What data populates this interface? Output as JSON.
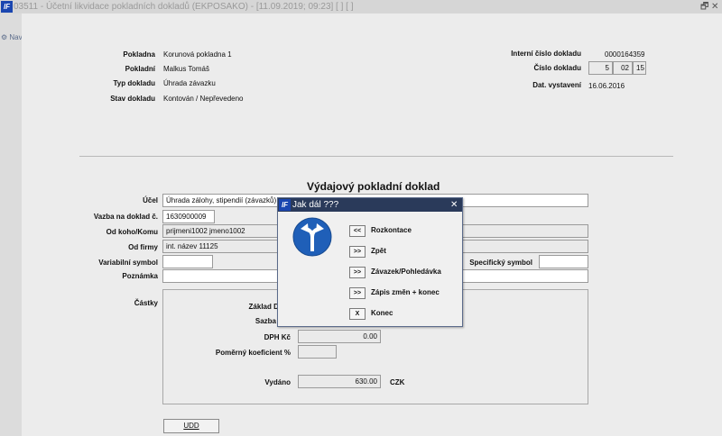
{
  "window": {
    "title": "03511 - Účetní likvidace pokladních dokladů (EKPOSAKO) - [11.09.2019; 09:23]  [  ]  [  ]",
    "app_icon": "lF",
    "restore": "🗗",
    "close": "✕"
  },
  "sidebar": {
    "nav_label": "Nav"
  },
  "header": {
    "pokladna_label": "Pokladna",
    "pokladna_value": "Korunová pokladna 1",
    "pokladni_label": "Pokladní",
    "pokladni_value": "Malkus Tomáš",
    "typ_label": "Typ dokladu",
    "typ_value": "Úhrada závazku",
    "stav_label": "Stav dokladu",
    "stav_value": "Kontován / Nepřevedeno",
    "interni_label": "Interní číslo dokladu",
    "interni_value": "0000164359",
    "cislo_label": "Číslo dokladu",
    "cislo_parts": [
      "5",
      "02",
      "15"
    ],
    "dat_label": "Dat. vystavení",
    "dat_value": "16.06.2016"
  },
  "form": {
    "section_title": "Výdajový pokladní doklad",
    "ucel_label": "Účel",
    "ucel_value": "Úhrada zálohy, stipendií  (závazků)",
    "vazba_label": "Vazba na doklad č.",
    "vazba_value": "1630900009",
    "odkoho_label": "Od koho/Komu",
    "odkoho_value": "prijmeni1002 jmeno1002",
    "odfirmy_label": "Od firmy",
    "odfirmy_value": "int. název 11125",
    "vs_label": "Variabilní symbol",
    "vs_value": "",
    "ss_label": "Specifický symbol",
    "ss_value": "",
    "poznamka_label": "Poznámka",
    "poznamka_value": ""
  },
  "castky": {
    "label": "Částky",
    "zaklad_label": "Základ DPH",
    "sazba_label": "Sazba",
    "dph_label": "DPH Kč",
    "dph_value": "0.00",
    "pomer_label": "Poměrný koeficient %",
    "pomer_value": "",
    "vydano_label": "Vydáno",
    "vydano_value": "630.00",
    "currency": "CZK"
  },
  "buttons": {
    "udd_label": "UDD"
  },
  "dialog": {
    "icon": "lF",
    "title": "Jak dál ???",
    "close": "✕",
    "sign_icon": "fork-arrow-sign",
    "options": [
      {
        "key": "<<",
        "label": "Rozkontace"
      },
      {
        "key": ">>",
        "label": "Zpět"
      },
      {
        "key": ">>",
        "label": "Závazek/Pohledávka"
      },
      {
        "key": ">>",
        "label": "Zápis změn + konec"
      },
      {
        "key": "X",
        "label": "Konec"
      }
    ]
  }
}
